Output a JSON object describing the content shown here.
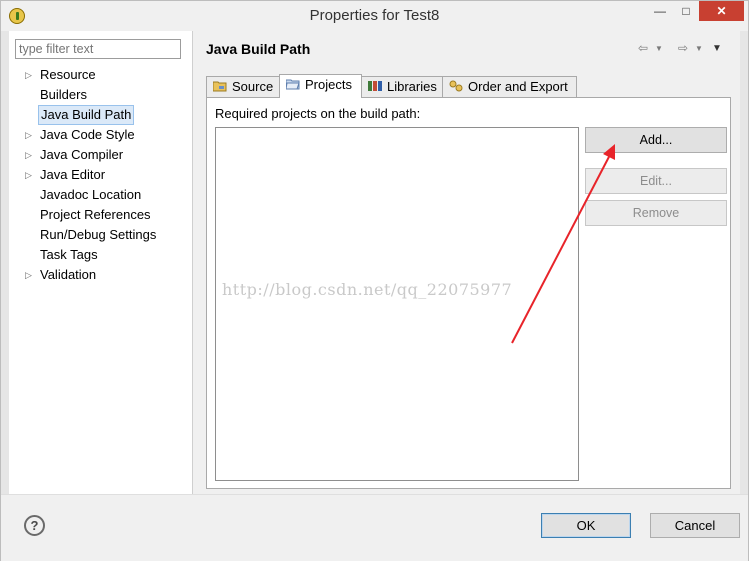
{
  "window": {
    "title": "Properties for Test8",
    "controls": {
      "minimize": "—",
      "maximize": "□",
      "close": "✕"
    }
  },
  "sidebar": {
    "filter_placeholder": "type filter text",
    "filter_value": "",
    "items": [
      {
        "label": "Resource",
        "expandable": true,
        "selected": false
      },
      {
        "label": "Builders",
        "expandable": false,
        "selected": false
      },
      {
        "label": "Java Build Path",
        "expandable": false,
        "selected": true
      },
      {
        "label": "Java Code Style",
        "expandable": true,
        "selected": false
      },
      {
        "label": "Java Compiler",
        "expandable": true,
        "selected": false
      },
      {
        "label": "Java Editor",
        "expandable": true,
        "selected": false
      },
      {
        "label": "Javadoc Location",
        "expandable": false,
        "selected": false
      },
      {
        "label": "Project References",
        "expandable": false,
        "selected": false
      },
      {
        "label": "Run/Debug Settings",
        "expandable": false,
        "selected": false
      },
      {
        "label": "Task Tags",
        "expandable": false,
        "selected": false
      },
      {
        "label": "Validation",
        "expandable": true,
        "selected": false
      }
    ]
  },
  "page": {
    "title": "Java Build Path",
    "nav": {
      "back": "⇦",
      "back_menu": "▼",
      "forward": "⇨",
      "forward_menu": "▼",
      "view_menu": "▼"
    },
    "tabs": [
      {
        "label": "Source",
        "icon": "source-folder-icon",
        "active": false
      },
      {
        "label": "Projects",
        "icon": "project-folder-icon",
        "active": true
      },
      {
        "label": "Libraries",
        "icon": "libraries-icon",
        "active": false
      },
      {
        "label": "Order and Export",
        "icon": "order-export-icon",
        "active": false
      }
    ],
    "projects_panel": {
      "label": "Required projects on the build path:",
      "projects": [],
      "buttons": {
        "add": "Add...",
        "edit": "Edit...",
        "remove": "Remove"
      }
    }
  },
  "watermark": "http://blog.csdn.net/qq_22075977",
  "footer": {
    "help_icon": "?",
    "ok": "OK",
    "cancel": "Cancel"
  },
  "colors": {
    "selection_bg": "#dbe9f8",
    "close_button": "#c84031",
    "annotation_arrow": "#e8242a"
  }
}
